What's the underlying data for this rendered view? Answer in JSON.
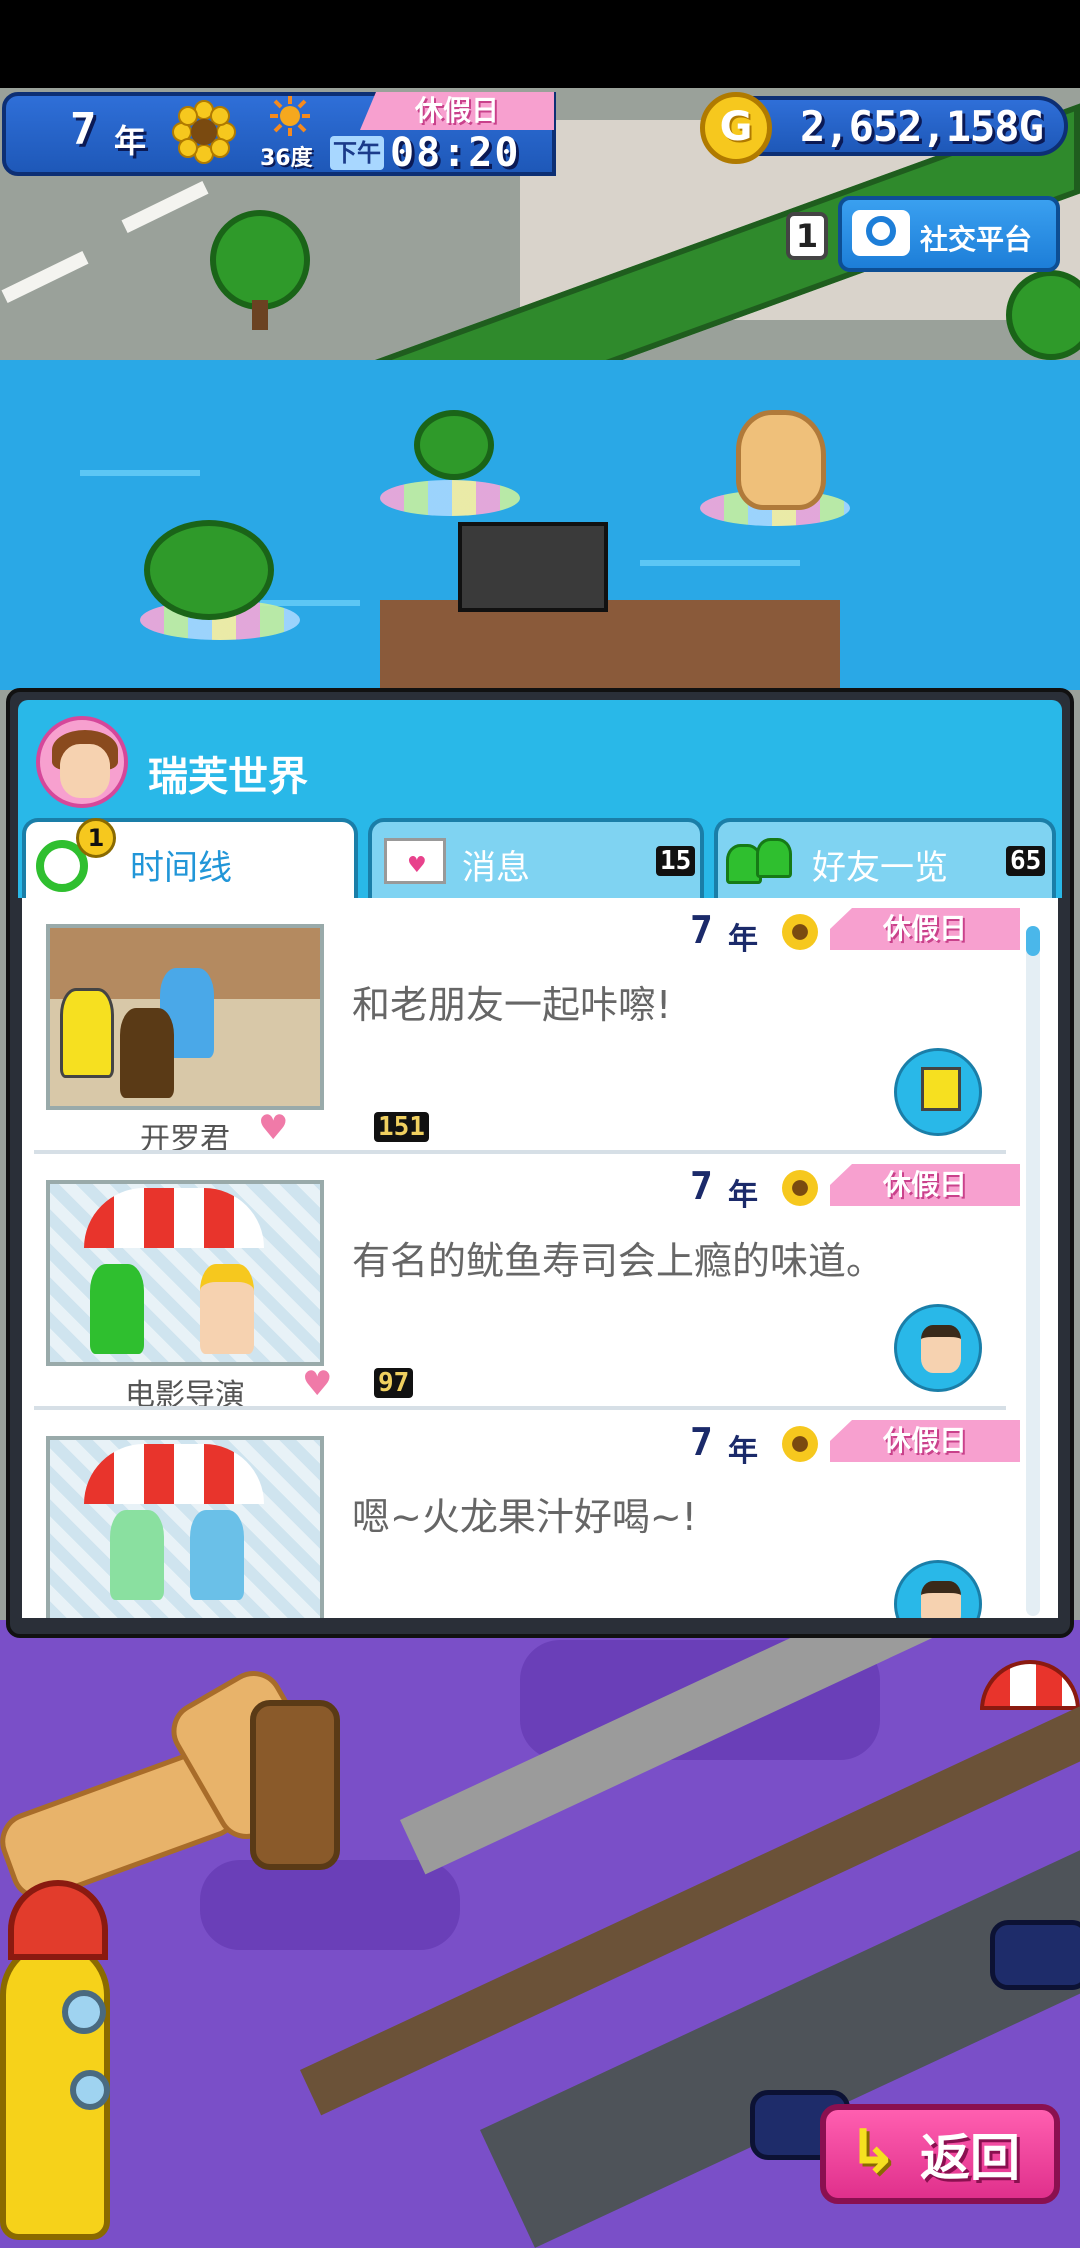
{
  "hud": {
    "year": "7",
    "year_unit": "年",
    "temperature": "36度",
    "day_type": "休假日",
    "ampm": "下午",
    "time": "08:20",
    "money": "2,652,158",
    "money_unit": "G",
    "coin_symbol": "G",
    "season_icon": "sunflower-icon",
    "weather_icon": "sun-icon"
  },
  "social": {
    "badge_count": "1",
    "label": "社交平台",
    "icon": "camera-icon"
  },
  "panel": {
    "title": "瑞芙世界",
    "tabs": [
      {
        "label": "时间线",
        "badge": "1",
        "icon": "clock-icon",
        "active": true
      },
      {
        "label": "消息",
        "count": "15",
        "icon": "envelope-icon",
        "active": false
      },
      {
        "label": "好友一览",
        "count": "65",
        "icon": "friends-icon",
        "active": false
      }
    ],
    "entries": [
      {
        "year": "7",
        "year_unit": "年",
        "day_type": "休假日",
        "text": "和老朋友一起咔嚓!",
        "caption": "开罗君",
        "likes": "151"
      },
      {
        "year": "7",
        "year_unit": "年",
        "day_type": "休假日",
        "text": "有名的鱿鱼寿司会上瘾的味道。",
        "caption": "电影导演",
        "likes": "97"
      },
      {
        "year": "7",
        "year_unit": "年",
        "day_type": "休假日",
        "text": "嗯~火龙果汁好喝~!",
        "caption": "",
        "likes": ""
      }
    ]
  },
  "return_button": {
    "label": "返回",
    "icon": "return-arrow-icon"
  },
  "colors": {
    "hud_blue": "#1e58b8",
    "holiday_pink": "#f7a0cf",
    "panel_header": "#29b8e8",
    "return_pink": "#e0308c"
  }
}
